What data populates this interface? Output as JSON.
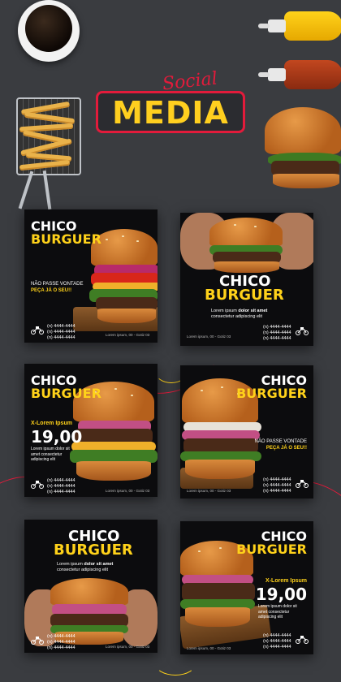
{
  "header": {
    "logo_script": "Social",
    "logo_word": "MEDIA"
  },
  "brand": {
    "line1": "CHICO",
    "line2": "BURGUER"
  },
  "colors": {
    "yellow": "#ffd21a",
    "red": "#e21b3b",
    "background": "#3a3c40",
    "card": "#0c0c0e"
  },
  "cards": [
    {
      "tagline1": "NÃO PASSE VONTADE",
      "tagline2": "PEÇA JÁ O SEU!!",
      "phones": [
        "(n) 4444-4444",
        "(n) 4444-4444",
        "(n) 4444-4444"
      ],
      "instagram": "Lorem ipsum, 00 - Gotiz 03",
      "icon": "delivery-moto-icon"
    },
    {
      "body_pre": "Lorem ipsum ",
      "body_bold": "dolor sit amet",
      "body_post": " consectetur adipiscing elit",
      "phones": [
        "(n) 4444-4444",
        "(n) 4444-4444",
        "(n) 4444-4444"
      ],
      "instagram": "Lorem ipsum, 00 - Gotiz 03",
      "icon": "delivery-moto-icon"
    },
    {
      "promo": "X-Lorem Ipsum",
      "price": "19,00",
      "body": "Lorem ipsum dolor sit amet consectetur adipiscing elit",
      "phones": [
        "(n) 4444-4444",
        "(n) 4444-4444",
        "(n) 4444-4444"
      ],
      "instagram": "Lorem ipsum, 00 - Gotiz 03",
      "icon": "delivery-moto-icon"
    },
    {
      "tagline1": "NÃO PASSE VONTADE",
      "tagline2": "PEÇA JÁ O SEU!!",
      "phones": [
        "(n) 4444-4444",
        "(n) 4444-4444",
        "(n) 4444-4444"
      ],
      "instagram": "Lorem ipsum, 00 - Gotiz 03",
      "icon": "delivery-moto-icon"
    },
    {
      "body_pre": "Lorem ipsum ",
      "body_bold": "dolor sit amet",
      "body_post": " consectetur adipiscing elit",
      "phones": [
        "(n) 4444-4444",
        "(n) 4444-4444",
        "(n) 4444-4444"
      ],
      "instagram": "Lorem ipsum, 00 - Gotiz 03",
      "icon": "delivery-moto-icon"
    },
    {
      "promo": "X-Lorem Ipsum",
      "price": "19,00",
      "body": "Lorem ipsum dolor sit amet consectetur adipiscing elit",
      "phones": [
        "(n) 4444-4444",
        "(n) 4444-4444",
        "(n) 4444-4444"
      ],
      "instagram": "Lorem ipsum, 00 - Gotiz 03",
      "icon": "delivery-moto-icon"
    }
  ]
}
